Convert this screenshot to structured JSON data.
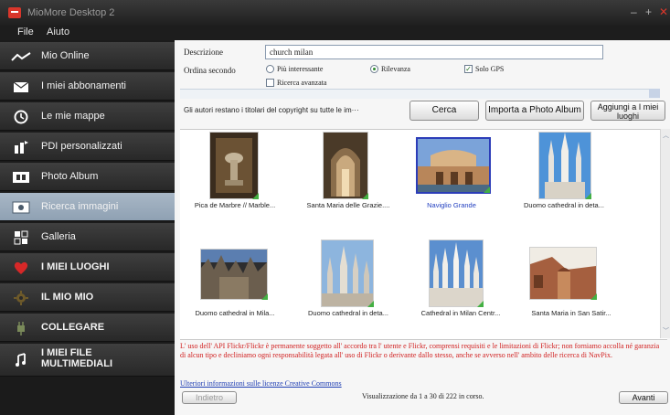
{
  "window": {
    "title": "MioMore Desktop 2",
    "controls": [
      "–",
      "+",
      "✕"
    ]
  },
  "menu": [
    "File",
    "Aiuto"
  ],
  "sidebar": {
    "items": [
      {
        "label": "Mio Online",
        "icon": "signal-icon"
      },
      {
        "label": "I miei abbonamenti",
        "icon": "envelope-icon"
      },
      {
        "label": "Le mie mappe",
        "icon": "compass-icon"
      },
      {
        "label": "PDI personalizzati",
        "icon": "poi-flag-icon"
      },
      {
        "label": "Photo Album",
        "icon": "film-icon"
      },
      {
        "label": "Ricerca immagini",
        "icon": "image-search-icon"
      },
      {
        "label": "Galleria",
        "icon": "gallery-grid-icon"
      },
      {
        "label": "I MIEI LUOGHI",
        "icon": "heart-icon"
      },
      {
        "label": "IL MIO MIO",
        "icon": "gear-icon"
      },
      {
        "label": "COLLEGARE",
        "icon": "plug-icon"
      },
      {
        "label": "I MIEI FILE MULTIMEDIALI",
        "icon": "music-note-icon"
      }
    ],
    "active_index": 5
  },
  "search": {
    "description_label": "Descrizione",
    "description_value": "church milan",
    "sort_label": "Ordina secondo",
    "sort_options": [
      "Più interessante",
      "Rilevanza"
    ],
    "sort_selected": "Rilevanza",
    "gps_only_label": "Solo GPS",
    "gps_only_checked": true,
    "advanced_label": "Ricerca avanzata",
    "advanced_checked": false
  },
  "toolbar": {
    "copyright_text": "Gli autori restano i titolari del copyright su tutte le im···",
    "search_button": "Cerca",
    "import_button": "Importa a Photo Album",
    "add_button": "Aggiungi a I miei luoghi"
  },
  "results": [
    {
      "caption": "Pica de Marbre // Marble...",
      "selected": false
    },
    {
      "caption": "Santa Maria delle Grazie....",
      "selected": false
    },
    {
      "caption": "Naviglio Grande",
      "selected": true
    },
    {
      "caption": "Duomo cathedral in deta...",
      "selected": false
    },
    {
      "caption": "Duomo cathedral in Mila...",
      "selected": false
    },
    {
      "caption": "Duomo cathedral in deta...",
      "selected": false
    },
    {
      "caption": "Cathedral in Milan Centr...",
      "selected": false
    },
    {
      "caption": "Santa Maria in San Satir...",
      "selected": false
    }
  ],
  "footer": {
    "notice": "L' uso dell' API Flickr/Flickr è permanente soggetto all' accordo tra l' utente e Flickr, comprensi requisiti e le limitazioni di Flickr; non forniamo accolla né garanzia di alcun tipo e decliniamo ogni responsabilità legata all' uso di Flickr o derivante dallo stesso, anche se avverso nell' ambito delle ricerca di NavPix.",
    "license_link": "Ulteriori informazioni sulle licenze Creative Commons",
    "back_button": "Indietro",
    "status": "Visualizzazione da 1 a 30 di 222 in corso.",
    "next_button": "Avanti"
  }
}
